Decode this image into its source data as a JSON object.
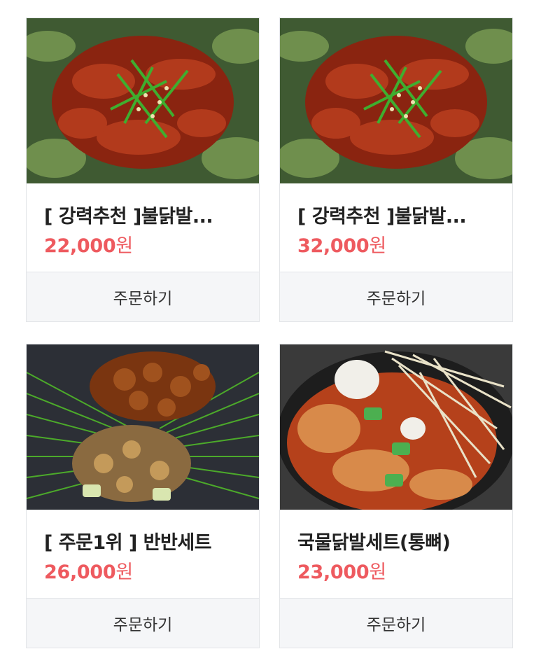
{
  "products": [
    {
      "title": "[ 강력추천 ]불닭발...",
      "price": "22,000",
      "currency": "원",
      "order_label": "주문하기",
      "image": "spicy-chicken-feet-photo"
    },
    {
      "title": "[ 강력추천 ]불닭발...",
      "price": "32,000",
      "currency": "원",
      "order_label": "주문하기",
      "image": "spicy-chicken-feet-photo"
    },
    {
      "title": "[ 주문1위 ] 반반세트",
      "price": "26,000",
      "currency": "원",
      "order_label": "주문하기",
      "image": "half-half-set-photo"
    },
    {
      "title": "국물닭발세트(통뼈)",
      "price": "23,000",
      "currency": "원",
      "order_label": "주문하기",
      "image": "soup-chicken-feet-photo"
    }
  ],
  "colors": {
    "price": "#ee5a5f",
    "title": "#222222",
    "button_bg": "#f5f6f8",
    "border": "#e3e5e8"
  }
}
